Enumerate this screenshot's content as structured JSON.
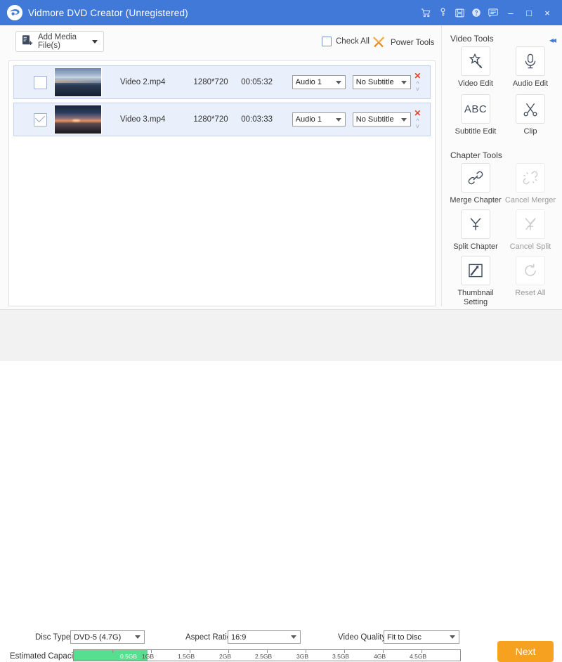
{
  "window": {
    "title": "Vidmore DVD Creator (Unregistered)",
    "accent": "#4179d8",
    "icons": [
      "cart-icon",
      "key-icon",
      "save-icon",
      "help-icon",
      "feedback-icon"
    ],
    "minimize": "–",
    "maximize": "□",
    "close": "×"
  },
  "toolbar": {
    "add_media_label": "Add Media File(s)",
    "add_media_icon": "add-file-icon",
    "check_all_label": "Check All",
    "check_all_checked": false,
    "power_tools_label": "Power Tools",
    "power_tools_icon": "power-tools-icon"
  },
  "file_list": {
    "rows": [
      {
        "checked": false,
        "name": "Video 2.mp4",
        "resolution": "1280*720",
        "duration": "00:05:32",
        "audio": "Audio 1",
        "subtitle": "No Subtitle",
        "remove_icon": "close-icon",
        "spinner_icon": "updown-icon"
      },
      {
        "checked": true,
        "name": "Video 3.mp4",
        "resolution": "1280*720",
        "duration": "00:03:33",
        "audio": "Audio 1",
        "subtitle": "No Subtitle",
        "remove_icon": "close-icon",
        "spinner_icon": "updown-icon"
      }
    ]
  },
  "right_panel": {
    "collapse_icon": "collapse-left-icon",
    "video_tools": {
      "title": "Video Tools",
      "items": [
        {
          "label": "Video Edit",
          "icon": "magic-wand-icon",
          "enabled": true
        },
        {
          "label": "Audio Edit",
          "icon": "microphone-icon",
          "enabled": true
        },
        {
          "label": "Subtitle Edit",
          "icon": "abc-icon",
          "enabled": true,
          "glyph": "ABC"
        },
        {
          "label": "Clip",
          "icon": "scissors-icon",
          "enabled": true
        }
      ]
    },
    "chapter_tools": {
      "title": "Chapter Tools",
      "items": [
        {
          "label": "Merge Chapter",
          "icon": "link-icon",
          "enabled": true
        },
        {
          "label": "Cancel Merger",
          "icon": "broken-link-icon",
          "enabled": false
        },
        {
          "label": "Split Chapter",
          "icon": "split-icon",
          "enabled": true
        },
        {
          "label": "Cancel Split",
          "icon": "cancel-split-icon",
          "enabled": false
        },
        {
          "label": "Thumbnail Setting",
          "icon": "thumbnail-icon",
          "enabled": true
        },
        {
          "label": "Reset All",
          "icon": "reset-icon",
          "enabled": false
        }
      ]
    }
  },
  "bottom": {
    "disc_type_label": "Disc Type",
    "disc_type_value": "DVD-5 (4.7G)",
    "aspect_ratio_label": "Aspect Ratio:",
    "aspect_ratio_value": "16:9",
    "video_quality_label": "Video Quality:",
    "video_quality_value": "Fit to Disc",
    "capacity_label": "Estimated Capacity:",
    "capacity_fill_label": "0.5GB",
    "capacity_fill_percent": 19,
    "capacity_ticks": [
      "1GB",
      "1.5GB",
      "2GB",
      "2.5GB",
      "3GB",
      "3.5GB",
      "4GB",
      "4.5GB"
    ],
    "capacity_max": "5GB",
    "next_label": "Next",
    "next_color": "#f7a120"
  }
}
